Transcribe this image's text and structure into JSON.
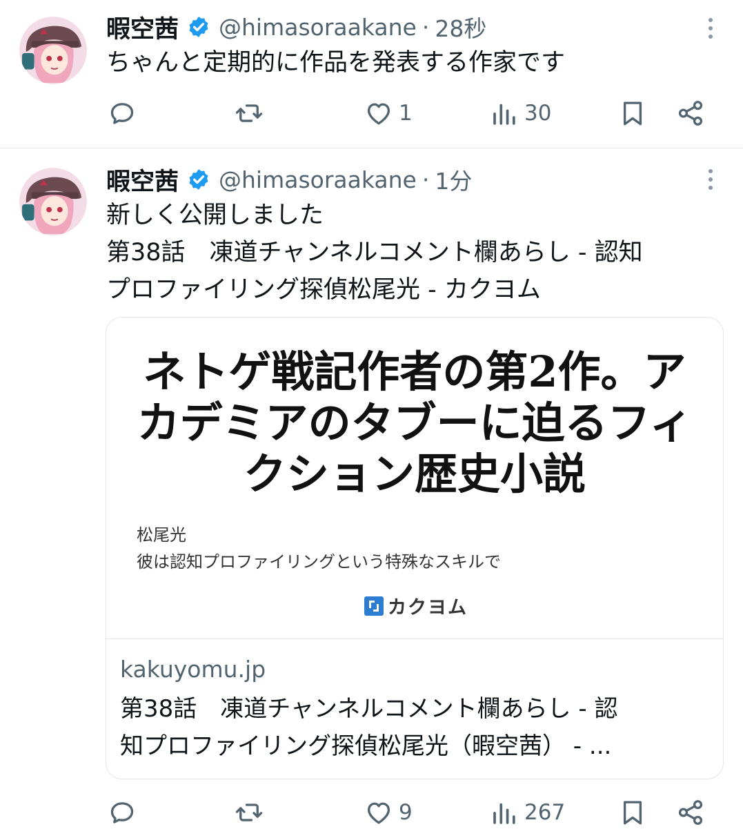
{
  "colors": {
    "text_primary": "#0f1419",
    "text_secondary": "#536471",
    "verified": "#1d9bf0",
    "divider": "#e6e9ec",
    "kakuyomu_brand": "#2c7cd1"
  },
  "tweets": [
    {
      "author": {
        "name": "暇空茜",
        "handle": "@himasoraakane",
        "verified_icon": "verified-badge-icon",
        "avatar_icon": "anime-avatar"
      },
      "separator": "·",
      "time": "28秒",
      "text_lines": [
        "ちゃんと定期的に作品を発表する作家です"
      ],
      "actions": {
        "reply": {
          "icon": "reply-icon",
          "count": ""
        },
        "retweet": {
          "icon": "retweet-icon",
          "count": ""
        },
        "like": {
          "icon": "heart-icon",
          "count": "1"
        },
        "views": {
          "icon": "views-icon",
          "count": "30"
        },
        "bookmark": {
          "icon": "bookmark-icon"
        },
        "share": {
          "icon": "share-icon"
        }
      }
    },
    {
      "author": {
        "name": "暇空茜",
        "handle": "@himasoraakane",
        "verified_icon": "verified-badge-icon",
        "avatar_icon": "anime-avatar"
      },
      "separator": "·",
      "time": "1分",
      "text_lines": [
        "新しく公開しました",
        "第38話　凍道チャンネルコメント欄あらし - 認知",
        "プロファイリング探偵松尾光 - カクヨム"
      ],
      "card": {
        "headline_lines": [
          "ネトゲ戦記作者の第2作。ア",
          "カデミアのタブーに迫るフィ",
          "クション歴史小説"
        ],
        "author": "松尾光",
        "description": "彼は認知プロファイリングという特殊なスキルで",
        "brand": "カクヨム",
        "domain": "kakuyomu.jp",
        "title_lines": [
          "第38話　凍道チャンネルコメント欄あらし - 認",
          "知プロファイリング探偵松尾光（暇空茜） - ..."
        ]
      },
      "actions": {
        "reply": {
          "icon": "reply-icon",
          "count": ""
        },
        "retweet": {
          "icon": "retweet-icon",
          "count": ""
        },
        "like": {
          "icon": "heart-icon",
          "count": "9"
        },
        "views": {
          "icon": "views-icon",
          "count": "267"
        },
        "bookmark": {
          "icon": "bookmark-icon"
        },
        "share": {
          "icon": "share-icon"
        }
      }
    }
  ]
}
